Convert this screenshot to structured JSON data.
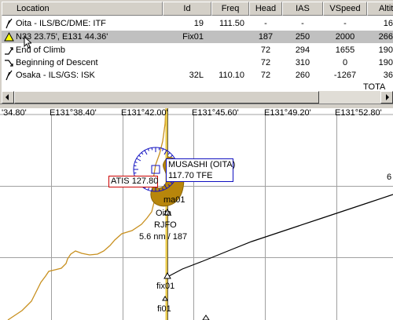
{
  "table": {
    "columns": [
      "Location",
      "Id",
      "Freq",
      "Head",
      "IAS",
      "VSpeed",
      "Altitu"
    ],
    "rows": [
      {
        "icon": "navaid-icon",
        "location": "Oita - ILS/BC/DME: ITF",
        "id": "19",
        "freq": "111.50",
        "head": "-",
        "ias": "-",
        "vspeed": "-",
        "alt": "16",
        "selected": false
      },
      {
        "icon": "warning-triangle-icon",
        "location": "N33 23.75', E131 44.36'",
        "id": "Fix01",
        "freq": "",
        "head": "187",
        "ias": "250",
        "vspeed": "2000",
        "alt": "266",
        "selected": true
      },
      {
        "icon": "climb-icon",
        "location": "End of Climb",
        "id": "",
        "freq": "",
        "head": "72",
        "ias": "294",
        "vspeed": "1655",
        "alt": "190",
        "selected": false
      },
      {
        "icon": "descent-icon",
        "location": "Beginning of Descent",
        "id": "",
        "freq": "",
        "head": "72",
        "ias": "310",
        "vspeed": "0",
        "alt": "190",
        "selected": false
      },
      {
        "icon": "navaid-icon",
        "location": "Osaka - ILS/GS: ISK",
        "id": "32L",
        "freq": "110.10",
        "head": "72",
        "ias": "260",
        "vspeed": "-1267",
        "alt": "36",
        "selected": false
      }
    ],
    "totals_label": "TOTA"
  },
  "map": {
    "grid_labels": [
      "'34.80'",
      "E131°38.40'",
      "E131°42.00'",
      "E131°45.60'",
      "E131°49.20'",
      "E131°52.80'"
    ],
    "vor_label_line1": "MUSASHI (OITA)",
    "vor_label_line2": "117.70 TFE",
    "atis_label": "ATIS 127.80",
    "airport_name": "Oita",
    "airport_icao": "RJFO",
    "airport_distance": "5.6 nm / 187",
    "waypoint_ma01": "ma01",
    "waypoint_fix01": "fix01",
    "waypoint_fi01": "fi01",
    "edge_label": "6",
    "colors": {
      "coast": "#c8901f",
      "runway": "#e8c84a",
      "airport": "#b8860b",
      "vor_ring": "#1010c0",
      "atis_box": "#cc0000",
      "route": "#000000"
    }
  }
}
